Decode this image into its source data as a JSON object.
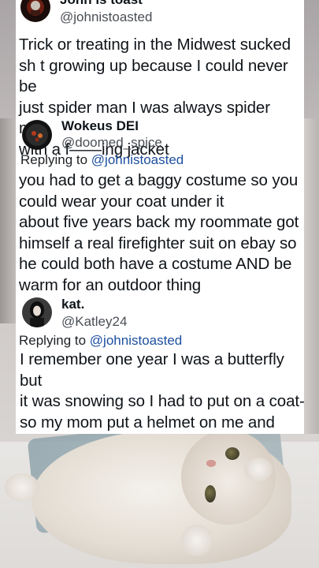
{
  "tweets": [
    {
      "name": "John is toast",
      "handle": "@johnistoasted",
      "text": "Trick or treating in the Midwest sucked\nsh t growing up because I could never be\njust spider man I was always spider man\nwith a f——ing jacket"
    },
    {
      "name": "Wokeus DEI",
      "handle": "@doomed_spice",
      "replying_prefix": "Replying to",
      "replying_to": "@johnistoasted",
      "text": "you had to get a baggy costume so you\ncould wear your coat under it\nabout five years back my roommate got\nhimself a real firefighter suit on ebay so\nhe could both have a costume AND be\nwarm for an outdoor thing"
    },
    {
      "name": "kat.",
      "handle": "@Katley24",
      "replying_prefix": "Replying to",
      "replying_to": "@johnistoasted",
      "text": "I remember one year I was a butterfly but\nit was snowing so I had to put on a coat-\nso my mom put a helmet on me and said\nI was a “snowmobiler” instead..."
    }
  ],
  "colors": {
    "card_bg": "#ffffff",
    "text": "#0f1419",
    "mention": "#1d4fa0"
  }
}
